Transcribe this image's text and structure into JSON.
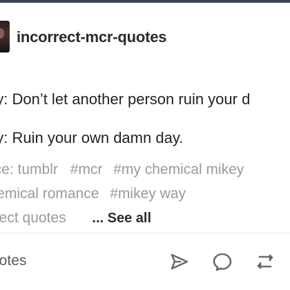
{
  "post": {
    "blog_name": "incorrect-mcr-quotes",
    "lines": [
      "ey: Don’t let another person ruin your d",
      "ey: Ruin your own damn day."
    ],
    "tags": {
      "row1": [
        "urce: tumblr",
        "#mcr",
        "#my chemical mikey"
      ],
      "row2": [
        "chemical romance",
        "#mikey way"
      ],
      "row3": [
        "orrect quotes"
      ],
      "see_all": "... See all"
    },
    "footer": {
      "notes_label": "notes",
      "icons": [
        "share-icon",
        "reply-icon",
        "reblog-icon"
      ]
    }
  },
  "colors": {
    "text": "#222222",
    "muted": "#9a9a9a",
    "divider": "#e8e8e8",
    "topbar": "#38444f"
  }
}
